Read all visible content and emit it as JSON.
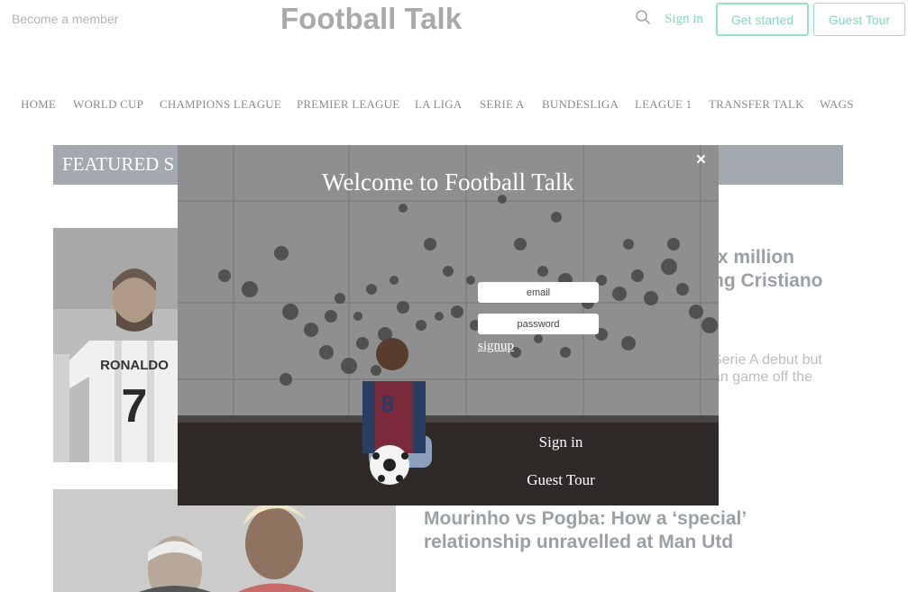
{
  "header": {
    "become_member": "Become a member",
    "logo": "Football Talk",
    "sign_in": "Sign in",
    "get_started": "Get started",
    "guest_tour": "Guest Tour"
  },
  "nav": [
    "HOME",
    "WORLD CUP",
    "CHAMPIONS LEAGUE",
    "PREMIER LEAGUE",
    "LA LIGA",
    "SERIE A",
    "BUNDESLIGA",
    "LEAGUE 1",
    "TRANSFER TALK",
    "WAGS"
  ],
  "featured": {
    "title_visible": "FEATURED S"
  },
  "articles": [
    {
      "title_lines": [
        "ix million",
        "ng Cristiano"
      ],
      "excerpt_lines": [
        "Serie A debut but",
        "an game off the"
      ],
      "image_text": {
        "shirt_name": "RONALDO",
        "shirt_number": "7"
      }
    },
    {
      "title_lines": [
        "Mourinho vs Pogba: How a ‘special’",
        "relationship unravelled at Man Utd"
      ]
    }
  ],
  "modal": {
    "title": "Welcome to Football Talk",
    "close": "×",
    "email_placeholder": "email",
    "password_placeholder": "password",
    "signup": "signup",
    "sign_in": "Sign in",
    "guest_tour": "Guest Tour",
    "jersey_number": "8"
  },
  "colors": {
    "accent": "#86d6bf",
    "featured_bar": "#a3a9ae",
    "logo": "#a9a9a9"
  }
}
